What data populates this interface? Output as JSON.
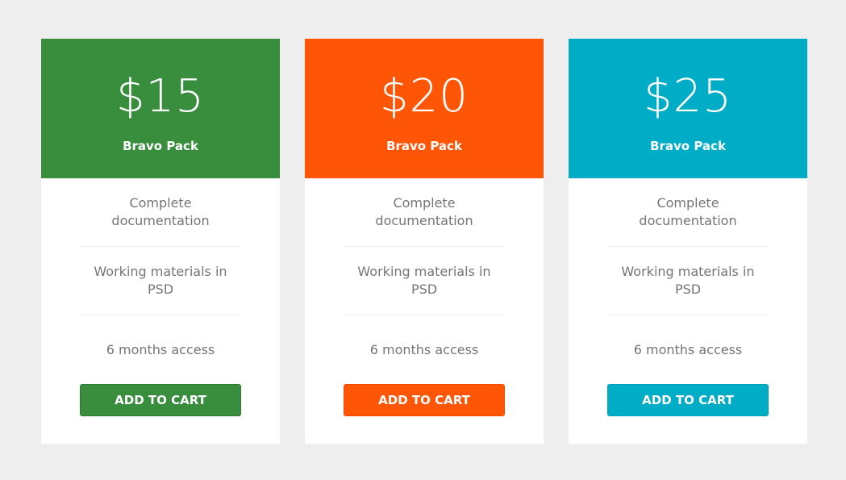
{
  "plans": [
    {
      "price": "$15",
      "name": "Bravo Pack",
      "features": [
        "Complete documentation",
        "Working materials in PSD",
        "6 months access"
      ],
      "button_label": "ADD TO CART",
      "color": "#388e3c"
    },
    {
      "price": "$20",
      "name": "Bravo Pack",
      "features": [
        "Complete documentation",
        "Working materials in PSD",
        "6 months access"
      ],
      "button_label": "ADD TO CART",
      "color": "#ff5506"
    },
    {
      "price": "$25",
      "name": "Bravo Pack",
      "features": [
        "Complete documentation",
        "Working materials in PSD",
        "6 months access"
      ],
      "button_label": "ADD TO CART",
      "color": "#00acc6"
    }
  ],
  "page_background": "#eeeeee",
  "feature_text_color": "#757575"
}
